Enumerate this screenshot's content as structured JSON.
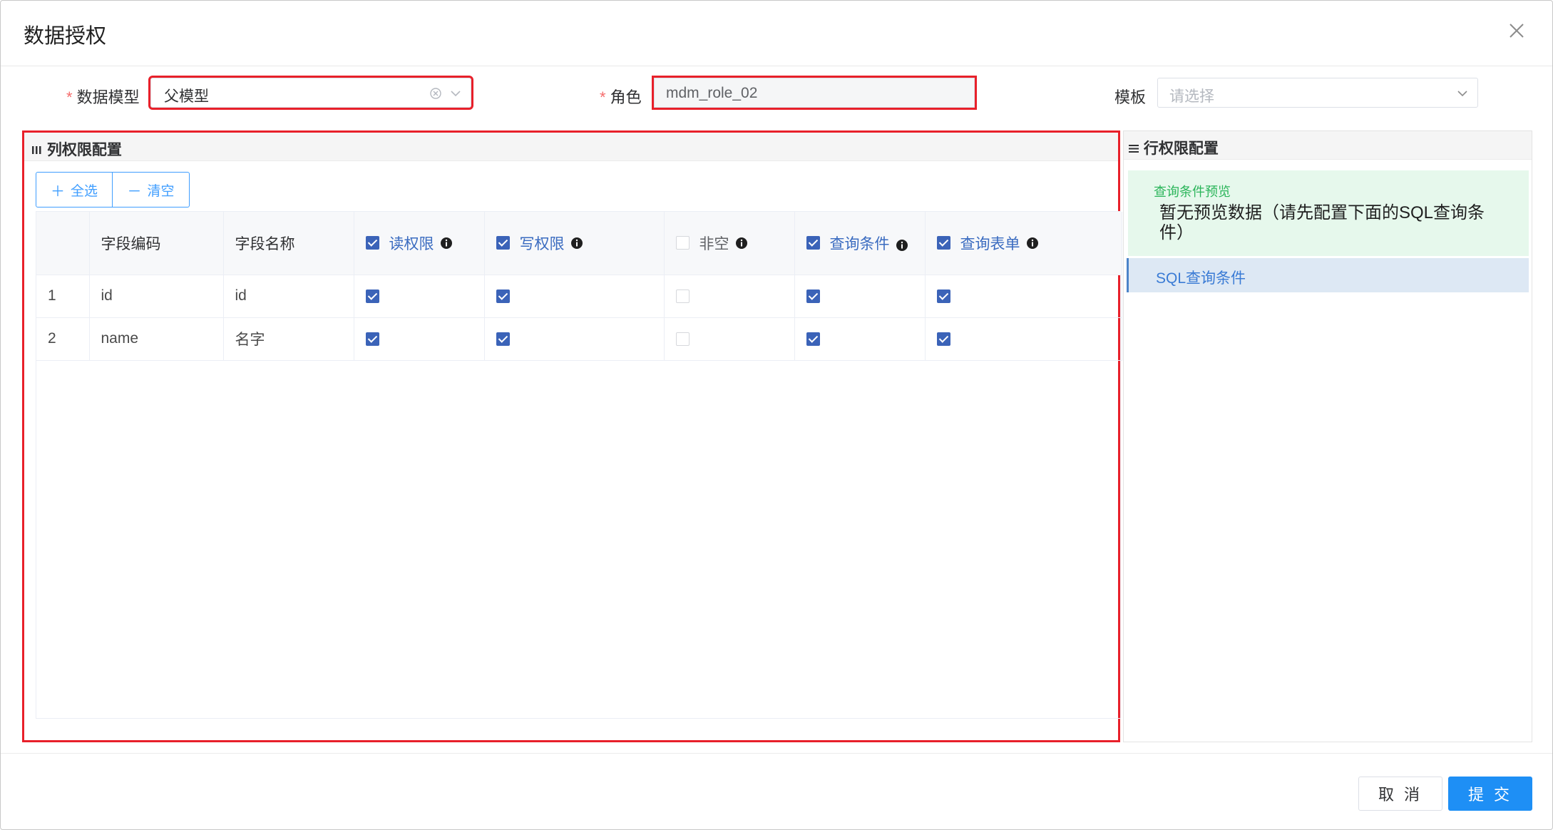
{
  "dialog": {
    "title": "数据授权",
    "close_icon": "close-icon"
  },
  "form": {
    "model_label": "数据模型",
    "model_value": "父模型",
    "role_label": "角色",
    "role_value": "mdm_role_02",
    "template_label": "模板",
    "template_placeholder": "请选择",
    "required_mark": "*"
  },
  "column_panel": {
    "title": "列权限配置",
    "title_icon": "columns-icon",
    "select_all": "全选",
    "clear": "清空",
    "headers": {
      "code": "字段编码",
      "name": "字段名称",
      "read": "读权限",
      "write": "写权限",
      "not_null": "非空",
      "query_cond": "查询条件",
      "query_form": "查询表单"
    },
    "header_checked": {
      "read": true,
      "write": true,
      "not_null": false,
      "query_cond": true,
      "query_form": true
    },
    "rows": [
      {
        "index": "1",
        "code": "id",
        "name": "id",
        "read": true,
        "write": true,
        "not_null": false,
        "query_cond": true,
        "query_form": true
      },
      {
        "index": "2",
        "code": "name",
        "name": "名字",
        "read": true,
        "write": true,
        "not_null": false,
        "query_cond": true,
        "query_form": true
      }
    ]
  },
  "row_panel": {
    "title": "行权限配置",
    "title_icon": "list-icon",
    "preview_label": "查询条件预览",
    "preview_text": "暂无预览数据（请先配置下面的SQL查询条件）",
    "sql_tab": "SQL查询条件"
  },
  "footer": {
    "cancel": "取 消",
    "submit": "提 交"
  },
  "colors": {
    "accent": "#409eff",
    "highlight": "#e8202a",
    "checkbox": "#3b63b8",
    "preview_bg": "#e6f8ec",
    "submit_bg": "#1e8ff5"
  }
}
